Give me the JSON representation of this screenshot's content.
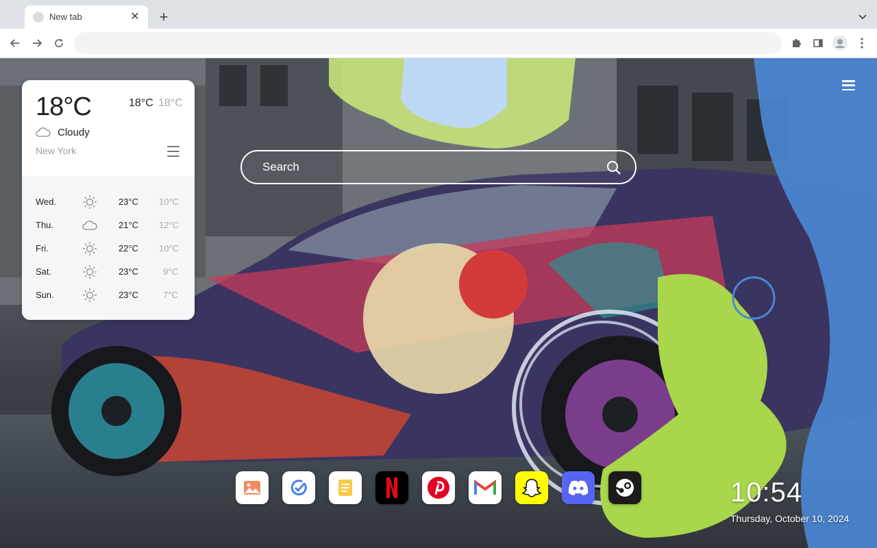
{
  "browser": {
    "tab": {
      "title": "New tab",
      "close_symbol": "✕"
    },
    "new_tab_symbol": "+",
    "address_bar": {
      "value": "",
      "placeholder": ""
    }
  },
  "weather": {
    "current_temp": "18°C",
    "high": "18°C",
    "low": "18°C",
    "condition": "Cloudy",
    "condition_icon": "cloud-icon",
    "city": "New York",
    "forecast": [
      {
        "day": "Wed.",
        "icon": "sun-icon",
        "high": "23°C",
        "low": "10°C"
      },
      {
        "day": "Thu.",
        "icon": "cloud-icon",
        "high": "21°C",
        "low": "12°C"
      },
      {
        "day": "Fri.",
        "icon": "sun-icon",
        "high": "22°C",
        "low": "10°C"
      },
      {
        "day": "Sat.",
        "icon": "sun-icon",
        "high": "23°C",
        "low": "9°C"
      },
      {
        "day": "Sun.",
        "icon": "sun-icon",
        "high": "23°C",
        "low": "7°C"
      }
    ]
  },
  "search": {
    "placeholder": "Search"
  },
  "dock": {
    "apps": [
      {
        "name": "photos-app-icon",
        "bg": "#ffffff"
      },
      {
        "name": "check-app-icon",
        "bg": "#ffffff"
      },
      {
        "name": "notes-app-icon",
        "bg": "#ffffff"
      },
      {
        "name": "netflix-icon",
        "bg": "#000000"
      },
      {
        "name": "pinterest-icon",
        "bg": "#ffffff"
      },
      {
        "name": "gmail-icon",
        "bg": "#ffffff"
      },
      {
        "name": "snapchat-icon",
        "bg": "#fffc00"
      },
      {
        "name": "discord-icon",
        "bg": "#5865f2"
      },
      {
        "name": "steam-icon",
        "bg": "#1b1b1b"
      }
    ]
  },
  "clock": {
    "time": "10:54",
    "date": "Thursday, October 10, 2024"
  },
  "colors": {
    "accent_green": "#a9d64a",
    "netflix_red": "#e50914",
    "pinterest_red": "#e60023"
  }
}
